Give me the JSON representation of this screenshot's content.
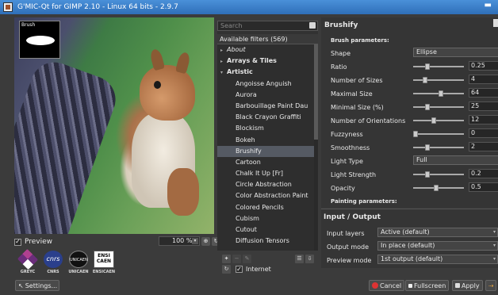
{
  "window": {
    "title": "G'MIC-Qt for GIMP 2.10 - Linux 64 bits - 2.9.7",
    "minimize_glyph": "▬"
  },
  "preview": {
    "thumbnail_label": "Brush",
    "preview_label": "Preview",
    "preview_checked": true,
    "zoom_value": "100 %",
    "logos": [
      "GREYC",
      "CNRS",
      "UNICAEN",
      "ENSICAEN"
    ],
    "logo_texts": {
      "cnrs": "cnrs",
      "unicaen": "UNICAEN",
      "ensi_line1": "ENSI",
      "ensi_line2": "CAEN"
    },
    "settings_label": "Settings..."
  },
  "filters": {
    "search_placeholder": "Search",
    "header": "Available filters (569)",
    "items": [
      {
        "label": "About",
        "type": "cat-italic",
        "arrow": "▸"
      },
      {
        "label": "Arrays & Tiles",
        "type": "cat",
        "arrow": "▸"
      },
      {
        "label": "Artistic",
        "type": "cat",
        "arrow": "▾"
      },
      {
        "label": "Angoisse Anguish",
        "type": "leaf"
      },
      {
        "label": "Aurora",
        "type": "leaf"
      },
      {
        "label": "Barbouillage Paint Dau",
        "type": "leaf"
      },
      {
        "label": "Black Crayon Graffiti",
        "type": "leaf"
      },
      {
        "label": "Blockism",
        "type": "leaf"
      },
      {
        "label": "Bokeh",
        "type": "leaf"
      },
      {
        "label": "Brushify",
        "type": "leaf",
        "selected": true
      },
      {
        "label": "Cartoon",
        "type": "leaf"
      },
      {
        "label": "Chalk It Up [Fr]",
        "type": "leaf"
      },
      {
        "label": "Circle Abstraction",
        "type": "leaf"
      },
      {
        "label": "Color Abstraction Paint",
        "type": "leaf"
      },
      {
        "label": "Colored Pencils",
        "type": "leaf"
      },
      {
        "label": "Cubism",
        "type": "leaf"
      },
      {
        "label": "Cutout",
        "type": "leaf"
      },
      {
        "label": "Diffusion Tensors",
        "type": "leaf"
      }
    ],
    "internet_label": "Internet",
    "internet_checked": true
  },
  "params": {
    "filter_name": "Brushify",
    "section_brush": "Brush parameters:",
    "shape_label": "Shape",
    "shape_value": "Ellipse",
    "sliders": [
      {
        "label": "Ratio",
        "value": "0.25",
        "knob_fraction": 0.25
      },
      {
        "label": "Number of Sizes",
        "value": "4",
        "knob_fraction": 0.2
      },
      {
        "label": "Maximal Size",
        "value": "64",
        "knob_fraction": 0.55
      },
      {
        "label": "Minimal Size (%)",
        "value": "25",
        "knob_fraction": 0.25
      },
      {
        "label": "Number of Orientations",
        "value": "12",
        "knob_fraction": 0.4
      },
      {
        "label": "Fuzzyness",
        "value": "0",
        "knob_fraction": 0.0
      },
      {
        "label": "Smoothness",
        "value": "2",
        "knob_fraction": 0.25
      }
    ],
    "light_type_label": "Light Type",
    "light_type_value": "Full",
    "sliders2": [
      {
        "label": "Light Strength",
        "value": "0.2",
        "knob_fraction": 0.25
      },
      {
        "label": "Opacity",
        "value": "0.5",
        "knob_fraction": 0.45
      }
    ],
    "section_painting": "Painting parameters:"
  },
  "io": {
    "title": "Input / Output",
    "rows": [
      {
        "label": "Input layers",
        "value": "Active (default)"
      },
      {
        "label": "Output mode",
        "value": "In place (default)"
      },
      {
        "label": "Preview mode",
        "value": "1st output (default)"
      }
    ]
  },
  "buttons": {
    "cancel": "Cancel",
    "fullscreen": "Fullscreen",
    "apply": "Apply"
  },
  "icons": {
    "dropdown": "▾",
    "refresh": "↻",
    "check": "✓"
  },
  "colors": {
    "titlebar": "#3b7fc9",
    "selected_row": "#555a63",
    "background": "#3b3b3b"
  }
}
